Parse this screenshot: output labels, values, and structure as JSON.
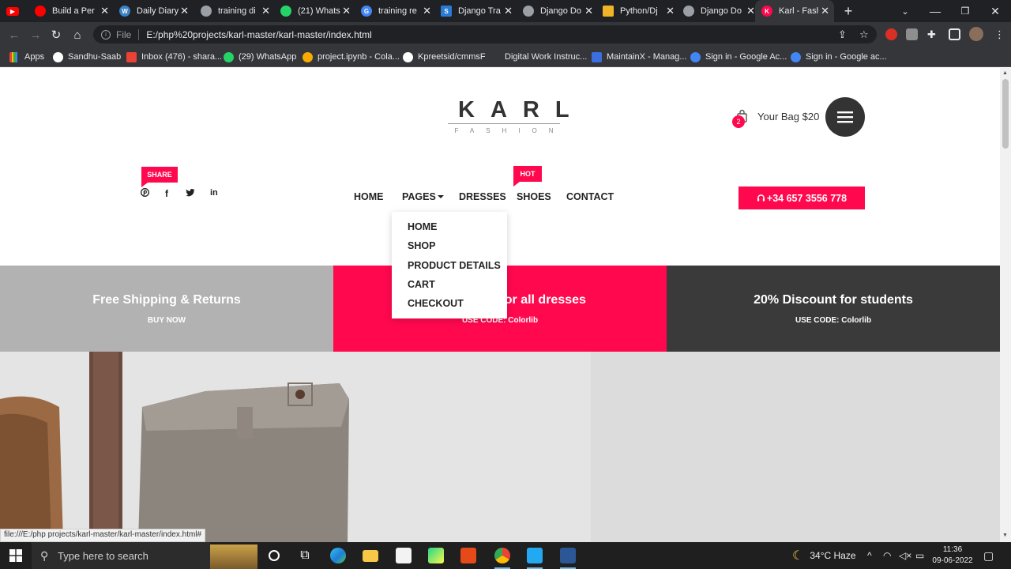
{
  "browser": {
    "tabs": [
      {
        "title": "Build a Per",
        "fav": "#ff0000"
      },
      {
        "title": "Daily Diary",
        "fav": "#3b82c4"
      },
      {
        "title": "training di",
        "fav": "#9aa0a6"
      },
      {
        "title": "(21) Whats",
        "fav": "#25d366"
      },
      {
        "title": "training re",
        "fav": "#4285f4"
      },
      {
        "title": "Django Tra",
        "fav": "#2b7bd6"
      },
      {
        "title": "Django Do",
        "fav": "#9aa0a6"
      },
      {
        "title": "Python/Dj",
        "fav": "#f0b429"
      },
      {
        "title": "Django Do",
        "fav": "#9aa0a6"
      },
      {
        "title": "Karl - Fash",
        "fav": "#ff084e"
      }
    ],
    "first_tab_icon": "youtube-icon",
    "new_tab": "+",
    "address": {
      "scheme": "File",
      "url": "E:/php%20projects/karl-master/karl-master/index.html"
    },
    "bookmarks": [
      {
        "label": "Apps",
        "color": "#ea4335"
      },
      {
        "label": "Sandhu-Saab",
        "color": "#ffffff"
      },
      {
        "label": "Inbox (476) - shara...",
        "color": "#ea4335"
      },
      {
        "label": "(29) WhatsApp",
        "color": "#25d366"
      },
      {
        "label": "project.ipynb - Cola...",
        "color": "#f9ab00"
      },
      {
        "label": "Kpreetsid/cmmsF",
        "color": "#ffffff"
      },
      {
        "label": "Digital Work Instruc...",
        "color": "#35363a"
      },
      {
        "label": "MaintainX - Manag...",
        "color": "#3b6fe0"
      },
      {
        "label": "Sign in - Google Ac...",
        "color": "#4285f4"
      },
      {
        "label": "Sign in - Google ac...",
        "color": "#4285f4"
      }
    ],
    "status_url": "file:///E:/php projects/karl-master/karl-master/index.html#"
  },
  "site": {
    "logo": {
      "main": "KARL",
      "sub": "FASHION"
    },
    "bag": {
      "count": "2",
      "label": "Your Bag $20"
    },
    "share_tag": "SHARE",
    "hot_tag": "HOT",
    "nav": [
      "HOME",
      "PAGES",
      "DRESSES",
      "SHOES",
      "CONTACT"
    ],
    "phone": "+34 657 3556 778",
    "dropdown": [
      "HOME",
      "SHOP",
      "PRODUCT DETAILS",
      "CART",
      "CHECKOUT"
    ],
    "promos": [
      {
        "title": "Free Shipping & Returns",
        "sub": "BUY NOW",
        "color": "#b2b2b2"
      },
      {
        "title": "20% Discount for all dresses",
        "sub": "USE CODE: Colorlib",
        "color": "#ff084e"
      },
      {
        "title": "20% Discount for students",
        "sub": "USE CODE: Colorlib",
        "color": "#3a3a3a"
      }
    ]
  },
  "taskbar": {
    "search_placeholder": "Type here to search",
    "weather": "34°C  Haze",
    "time": "11:36",
    "date": "09-06-2022"
  }
}
